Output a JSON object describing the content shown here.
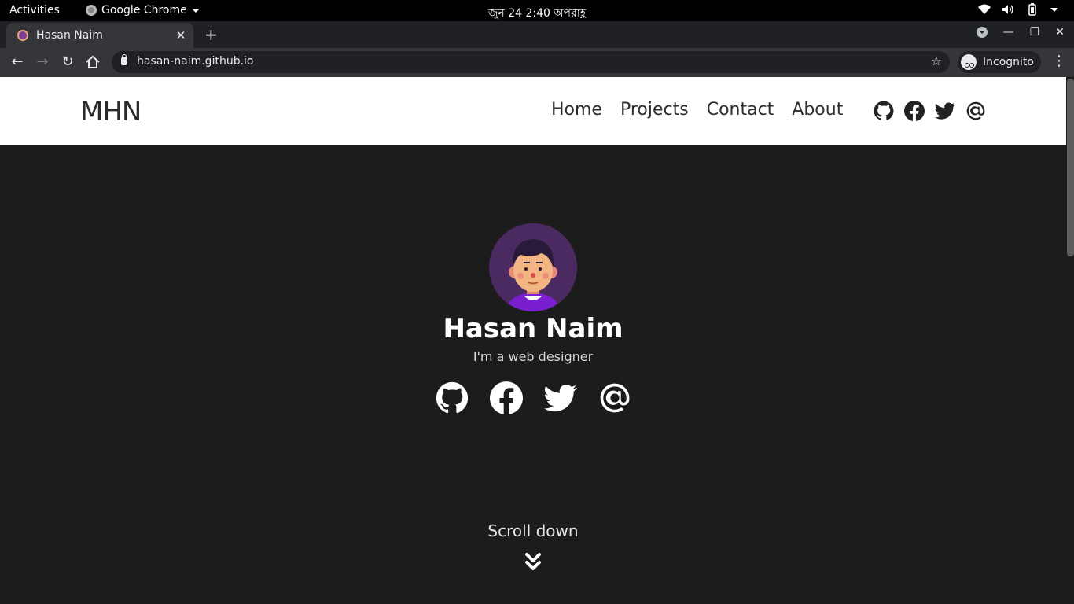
{
  "system_bar": {
    "activities": "Activities",
    "app_name": "Google Chrome",
    "clock": "জুন 24   2:40 অপরাহ্ণ"
  },
  "browser": {
    "tab_title": "Hasan Naim",
    "url": "hasan-naim.github.io",
    "profile_label": "Incognito"
  },
  "site": {
    "logo": "MHN",
    "nav": [
      "Home",
      "Projects",
      "Contact",
      "About"
    ],
    "name": "Hasan Naim",
    "tagline": "I'm a web designer",
    "scroll_label": "Scroll down",
    "social_icons": [
      "github-icon",
      "facebook-icon",
      "twitter-icon",
      "at-sign-icon"
    ]
  },
  "colors": {
    "page_background": "#1c1c1c",
    "header_background": "#ffffff",
    "avatar_background": "#4b2a62"
  }
}
